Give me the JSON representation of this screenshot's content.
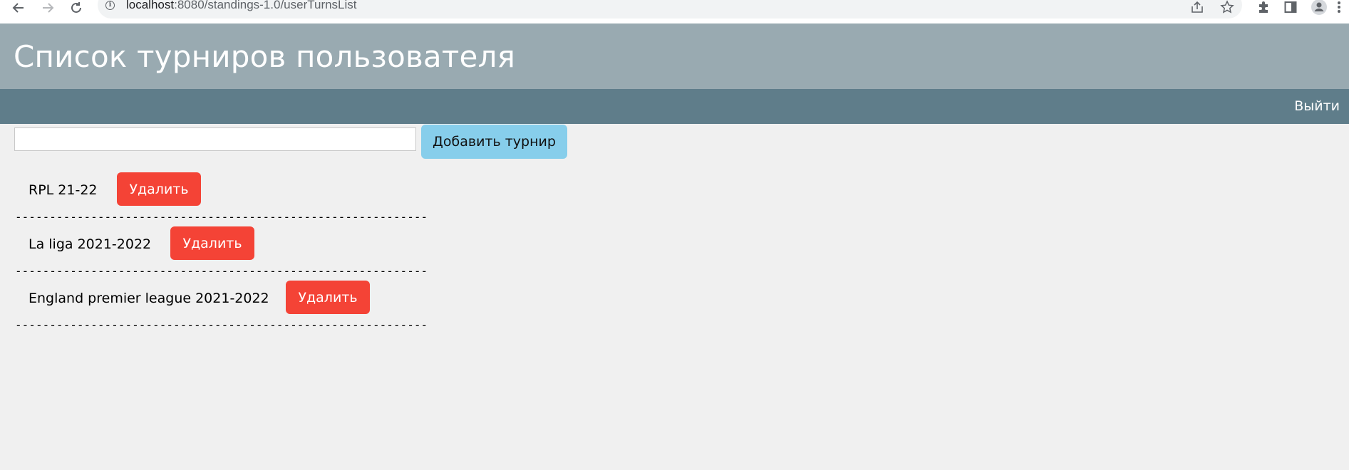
{
  "browser": {
    "url_host": "localhost",
    "url_path": ":8080/standings-1.0/userTurnsList"
  },
  "header": {
    "title": "Список турниров пользователя"
  },
  "navbar": {
    "logout_label": "Выйти"
  },
  "add_form": {
    "input_value": "",
    "add_button_label": "Добавить турнир"
  },
  "tournaments": [
    {
      "name": "RPL 21-22",
      "delete_label": "Удалить",
      "separator": "------------------------------------------------------------"
    },
    {
      "name": "La liga 2021-2022",
      "delete_label": "Удалить",
      "separator": "------------------------------------------------------------"
    },
    {
      "name": "England premier league 2021-2022",
      "delete_label": "Удалить",
      "separator": "------------------------------------------------------------"
    }
  ],
  "colors": {
    "header_bg": "#99aab1",
    "navbar_bg": "#5f7d8a",
    "add_button_bg": "#87ceeb",
    "delete_button_bg": "#f44336",
    "page_bg": "#f0f0f0"
  }
}
